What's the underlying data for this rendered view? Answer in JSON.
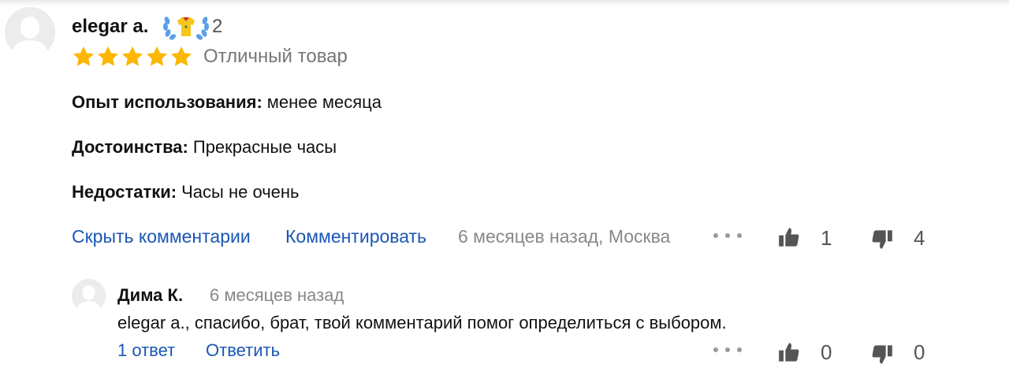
{
  "review": {
    "author": "elegar a.",
    "badge_count": "2",
    "stars": 5,
    "rating_text": "Отличный товар",
    "fields": [
      {
        "label": "Опыт использования:",
        "value": "менее месяца"
      },
      {
        "label": "Достоинства:",
        "value": "Прекрасные часы"
      },
      {
        "label": "Недостатки:",
        "value": "Часы не очень"
      }
    ],
    "actions": {
      "hide_comments": "Скрыть комментарии",
      "comment": "Комментировать"
    },
    "meta": "6 месяцев назад, Москва",
    "likes": "1",
    "dislikes": "4"
  },
  "comment": {
    "author": "Дима К.",
    "time": "6 месяцев назад",
    "text": "elegar a., спасибо, брат, твой комментарий помог определиться с выбором.",
    "replies_link": "1 ответ",
    "reply_action": "Ответить",
    "likes": "0",
    "dislikes": "0"
  },
  "colors": {
    "link": "#1a56b6",
    "star": "#fdb702",
    "muted": "#888888"
  },
  "icons": [
    "user-avatar-icon",
    "achievement-badge-icon",
    "star-icon",
    "more-dots-icon",
    "thumbs-up-icon",
    "thumbs-down-icon"
  ]
}
